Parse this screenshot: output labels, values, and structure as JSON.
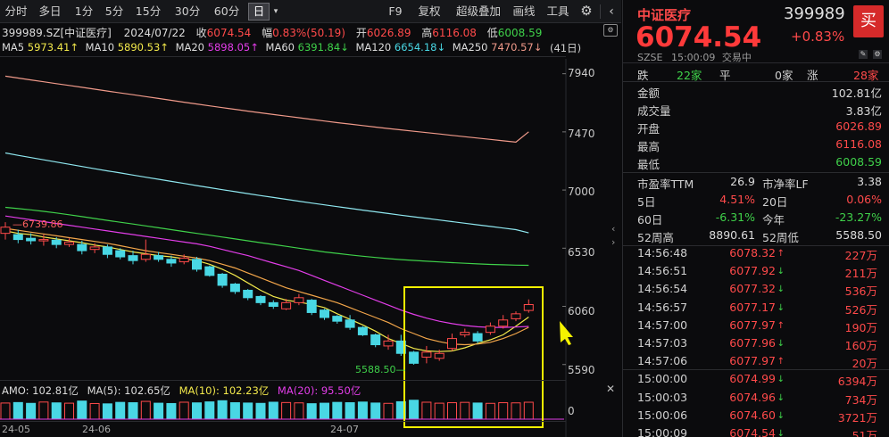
{
  "toolbar": {
    "periods": [
      "分时",
      "多日",
      "1分",
      "5分",
      "15分",
      "30分",
      "60分",
      "日"
    ],
    "active_period": "日",
    "tools": [
      "F9",
      "复权",
      "超级叠加",
      "画线",
      "工具"
    ]
  },
  "quote_line": {
    "code_name": "399989.SZ[中证医疗]",
    "date": "2024/07/22",
    "close_label": "收",
    "close": "6074.54",
    "range_label": "幅",
    "range": "0.83%(50.19)",
    "open_label": "开",
    "open": "6026.89",
    "high_label": "高",
    "high": "6116.08",
    "low_label": "低",
    "low": "6008.59"
  },
  "ma_line": {
    "ma5": "MA5",
    "ma5_val": "5973.41↑",
    "ma10": "MA10",
    "ma10_val": "5890.53↑",
    "ma20": "MA20",
    "ma20_val": "5898.05↑",
    "ma60": "MA60",
    "ma60_val": "6391.84↓",
    "ma120": "MA120",
    "ma120_val": "6654.18↓",
    "ma250": "MA250",
    "ma250_val": "7470.57↓",
    "day_count": "(41日)"
  },
  "chart_annotations": {
    "high_label": "6739.86",
    "low_label": "5588.50"
  },
  "amo_line": {
    "amo": "AMO: 102.81亿",
    "ma5": "MA(5): 102.65亿",
    "ma10": "MA(10): 102.23亿",
    "ma20": "MA(20): 95.50亿"
  },
  "axis_labels": {
    "price": [
      "7940",
      "7470",
      "7000",
      "6530",
      "6060",
      "5590"
    ],
    "volume_zero": "0",
    "dates": [
      "24-05",
      "24-06",
      "24-07"
    ]
  },
  "chart_data": {
    "type": "candlestick",
    "title": "399989.SZ[中证医疗]",
    "ylim": [
      5480,
      8060
    ],
    "candles": [
      {
        "o": 6650,
        "c": 6700,
        "h": 6739.86,
        "l": 6600
      },
      {
        "o": 6640,
        "c": 6600,
        "h": 6680,
        "l": 6570
      },
      {
        "o": 6610,
        "c": 6590,
        "h": 6650,
        "l": 6560
      },
      {
        "o": 6590,
        "c": 6600,
        "h": 6640,
        "l": 6550
      },
      {
        "o": 6595,
        "c": 6560,
        "h": 6620,
        "l": 6530
      },
      {
        "o": 6560,
        "c": 6580,
        "h": 6610,
        "l": 6540
      },
      {
        "o": 6560,
        "c": 6510,
        "h": 6590,
        "l": 6480
      },
      {
        "o": 6520,
        "c": 6540,
        "h": 6570,
        "l": 6490
      },
      {
        "o": 6540,
        "c": 6480,
        "h": 6560,
        "l": 6450
      },
      {
        "o": 6510,
        "c": 6460,
        "h": 6530,
        "l": 6440
      },
      {
        "o": 6470,
        "c": 6430,
        "h": 6510,
        "l": 6400
      },
      {
        "o": 6440,
        "c": 6480,
        "h": 6600,
        "l": 6420
      },
      {
        "o": 6470,
        "c": 6440,
        "h": 6500,
        "l": 6420
      },
      {
        "o": 6440,
        "c": 6410,
        "h": 6470,
        "l": 6380
      },
      {
        "o": 6420,
        "c": 6450,
        "h": 6480,
        "l": 6400
      },
      {
        "o": 6440,
        "c": 6360,
        "h": 6460,
        "l": 6340
      },
      {
        "o": 6380,
        "c": 6310,
        "h": 6390,
        "l": 6300
      },
      {
        "o": 6320,
        "c": 6230,
        "h": 6330,
        "l": 6210
      },
      {
        "o": 6240,
        "c": 6180,
        "h": 6250,
        "l": 6160
      },
      {
        "o": 6190,
        "c": 6130,
        "h": 6200,
        "l": 6110
      },
      {
        "o": 6140,
        "c": 6090,
        "h": 6150,
        "l": 6070
      },
      {
        "o": 6090,
        "c": 6060,
        "h": 6110,
        "l": 6040
      },
      {
        "o": 6040,
        "c": 6090,
        "h": 6120,
        "l": 6030
      },
      {
        "o": 6090,
        "c": 6130,
        "h": 6160,
        "l": 6070
      },
      {
        "o": 6110,
        "c": 6010,
        "h": 6120,
        "l": 5990
      },
      {
        "o": 6030,
        "c": 5970,
        "h": 6040,
        "l": 5950
      },
      {
        "o": 5980,
        "c": 5940,
        "h": 5990,
        "l": 5920
      },
      {
        "o": 5950,
        "c": 5890,
        "h": 5990,
        "l": 5870
      },
      {
        "o": 5890,
        "c": 5830,
        "h": 5900,
        "l": 5820
      },
      {
        "o": 5830,
        "c": 5750,
        "h": 5840,
        "l": 5730
      },
      {
        "o": 5740,
        "c": 5780,
        "h": 5830,
        "l": 5710
      },
      {
        "o": 5780,
        "c": 5680,
        "h": 5830,
        "l": 5660
      },
      {
        "o": 5690,
        "c": 5600,
        "h": 5700,
        "l": 5588.5
      },
      {
        "o": 5650,
        "c": 5690,
        "h": 5740,
        "l": 5600
      },
      {
        "o": 5640,
        "c": 5680,
        "h": 5710,
        "l": 5620
      },
      {
        "o": 5720,
        "c": 5800,
        "h": 5840,
        "l": 5700
      },
      {
        "o": 5830,
        "c": 5850,
        "h": 5880,
        "l": 5810
      },
      {
        "o": 5840,
        "c": 5780,
        "h": 5860,
        "l": 5760
      },
      {
        "o": 5850,
        "c": 5900,
        "h": 5930,
        "l": 5830
      },
      {
        "o": 5900,
        "c": 5950,
        "h": 5990,
        "l": 5880
      },
      {
        "o": 5960,
        "c": 6000,
        "h": 6020,
        "l": 5940
      },
      {
        "o": 6026.89,
        "c": 6074.54,
        "h": 6116.08,
        "l": 6008.59
      }
    ],
    "ma_series": [
      {
        "name": "MA5",
        "color": "#f2e84b",
        "values": [
          6670,
          6650,
          6640,
          6620,
          6605,
          6590,
          6575,
          6555,
          6540,
          6520,
          6500,
          6485,
          6470,
          6460,
          6445,
          6430,
          6400,
          6360,
          6310,
          6250,
          6190,
          6140,
          6110,
          6095,
          6075,
          6050,
          6000,
          5955,
          5910,
          5860,
          5800,
          5760,
          5720,
          5700,
          5695,
          5700,
          5725,
          5760,
          5790,
          5830,
          5900,
          5973.41
        ]
      },
      {
        "name": "MA10",
        "color": "#f3a64a",
        "values": [
          6690,
          6675,
          6660,
          6645,
          6630,
          6615,
          6600,
          6585,
          6570,
          6550,
          6530,
          6510,
          6495,
          6480,
          6465,
          6450,
          6430,
          6400,
          6370,
          6330,
          6290,
          6250,
          6210,
          6180,
          6150,
          6120,
          6090,
          6050,
          6010,
          5970,
          5930,
          5880,
          5840,
          5800,
          5775,
          5755,
          5750,
          5755,
          5770,
          5800,
          5840,
          5890.53
        ]
      },
      {
        "name": "MA20",
        "color": "#e23de8",
        "values": [
          6790,
          6775,
          6760,
          6745,
          6730,
          6715,
          6700,
          6685,
          6670,
          6655,
          6640,
          6625,
          6610,
          6595,
          6580,
          6565,
          6545,
          6520,
          6495,
          6470,
          6440,
          6410,
          6380,
          6350,
          6310,
          6270,
          6230,
          6190,
          6150,
          6110,
          6070,
          6030,
          5995,
          5965,
          5940,
          5920,
          5905,
          5895,
          5890,
          5890,
          5893,
          5898.05
        ]
      },
      {
        "name": "MA60",
        "color": "#3fd14a",
        "values": [
          6860,
          6850,
          6840,
          6828,
          6815,
          6800,
          6785,
          6770,
          6755,
          6740,
          6725,
          6710,
          6695,
          6680,
          6665,
          6650,
          6635,
          6620,
          6605,
          6590,
          6575,
          6560,
          6545,
          6530,
          6515,
          6500,
          6488,
          6476,
          6465,
          6455,
          6446,
          6438,
          6431,
          6425,
          6419,
          6413,
          6408,
          6403,
          6399,
          6396,
          6393,
          6391.84
        ]
      },
      {
        "name": "MA120",
        "color": "#8fe7ef",
        "values": [
          7300,
          7280,
          7262,
          7244,
          7226,
          7208,
          7190,
          7172,
          7155,
          7138,
          7121,
          7104,
          7087,
          7070,
          7053,
          7036,
          7019,
          7003,
          6987,
          6971,
          6955,
          6940,
          6925,
          6910,
          6895,
          6880,
          6866,
          6852,
          6838,
          6824,
          6810,
          6797,
          6784,
          6771,
          6758,
          6745,
          6732,
          6719,
          6706,
          6693,
          6680,
          6654.18
        ]
      },
      {
        "name": "MA250",
        "color": "#f09a8a",
        "values": [
          7920,
          7905,
          7890,
          7875,
          7860,
          7845,
          7830,
          7815,
          7800,
          7785,
          7770,
          7755,
          7740,
          7725,
          7710,
          7695,
          7680,
          7666,
          7652,
          7638,
          7624,
          7610,
          7597,
          7584,
          7571,
          7558,
          7545,
          7533,
          7521,
          7509,
          7497,
          7486,
          7475,
          7464,
          7453,
          7442,
          7431,
          7420,
          7409,
          7398,
          7387,
          7470.57
        ]
      }
    ],
    "volume": [
      98,
      101,
      96,
      104,
      99,
      97,
      110,
      95,
      93,
      102,
      100,
      108,
      97,
      95,
      103,
      99,
      105,
      112,
      100,
      98,
      96,
      103,
      101,
      99,
      94,
      97,
      102,
      100,
      104,
      98,
      96,
      106,
      115,
      103,
      97,
      100,
      102,
      98,
      96,
      100,
      99,
      102.81
    ]
  },
  "right_panel": {
    "name": "中证医疗",
    "code": "399989",
    "price": "6074.54",
    "change_pct": "+0.83%",
    "buy_label": "买",
    "exchange": "SZSE",
    "time": "15:00:09",
    "status": "交易中",
    "breadth": {
      "down_label": "跌",
      "down": "22家",
      "flat_label": "平",
      "flat": "0家",
      "up_label": "涨",
      "up": "28家"
    },
    "stats": [
      {
        "label": "金额",
        "value": "102.81亿",
        "color": "white"
      },
      {
        "label": "成交量",
        "value": "3.83亿",
        "color": "white"
      },
      {
        "label": "开盘",
        "value": "6026.89",
        "color": "red"
      },
      {
        "label": "最高",
        "value": "6116.08",
        "color": "red"
      },
      {
        "label": "最低",
        "value": "6008.59",
        "color": "green"
      }
    ],
    "valuation": [
      {
        "l1": "市盈率TTM",
        "v1": "26.9",
        "c1": "white",
        "l2": "市净率LF",
        "v2": "3.38",
        "c2": "white"
      },
      {
        "l1": "5日",
        "v1": "4.51%",
        "c1": "red",
        "l2": "20日",
        "v2": "0.06%",
        "c2": "red"
      },
      {
        "l1": "60日",
        "v1": "-6.31%",
        "c1": "green",
        "l2": "今年",
        "v2": "-23.27%",
        "c2": "green"
      },
      {
        "l1": "52周高",
        "v1": "8890.61",
        "c1": "white",
        "l2": "52周低",
        "v2": "5588.50",
        "c2": "white"
      }
    ],
    "ticks": [
      {
        "time": "14:56:48",
        "price": "6078.32",
        "dir": "↑",
        "vol": "227万"
      },
      {
        "time": "14:56:51",
        "price": "6077.92",
        "dir": "↓",
        "vol": "211万"
      },
      {
        "time": "14:56:54",
        "price": "6077.32",
        "dir": "↓",
        "vol": "536万"
      },
      {
        "time": "14:56:57",
        "price": "6077.17",
        "dir": "↓",
        "vol": "526万"
      },
      {
        "time": "14:57:00",
        "price": "6077.97",
        "dir": "↑",
        "vol": "190万"
      },
      {
        "time": "14:57:03",
        "price": "6077.96",
        "dir": "↓",
        "vol": "160万"
      },
      {
        "time": "14:57:06",
        "price": "6077.97",
        "dir": "↑",
        "vol": "20万"
      },
      {
        "time": "15:00:00",
        "price": "6074.99",
        "dir": "↓",
        "vol": "6394万"
      },
      {
        "time": "15:00:03",
        "price": "6074.96",
        "dir": "↓",
        "vol": "734万"
      },
      {
        "time": "15:00:06",
        "price": "6074.60",
        "dir": "↓",
        "vol": "3721万"
      },
      {
        "time": "15:00:09",
        "price": "6074.54",
        "dir": "↓",
        "vol": "51万"
      }
    ]
  },
  "colors": {
    "up": "#ff4a4a",
    "down": "#49d7e4",
    "highlight": "#f5f200",
    "background": "#0b0b0d"
  },
  "icons": [
    "chevron-down-icon",
    "gear-icon",
    "settings-icon",
    "chevron-left-icon",
    "chevron-right-icon",
    "close-icon",
    "arrow-up-icon",
    "pencil-icon",
    "cursor-icon"
  ]
}
